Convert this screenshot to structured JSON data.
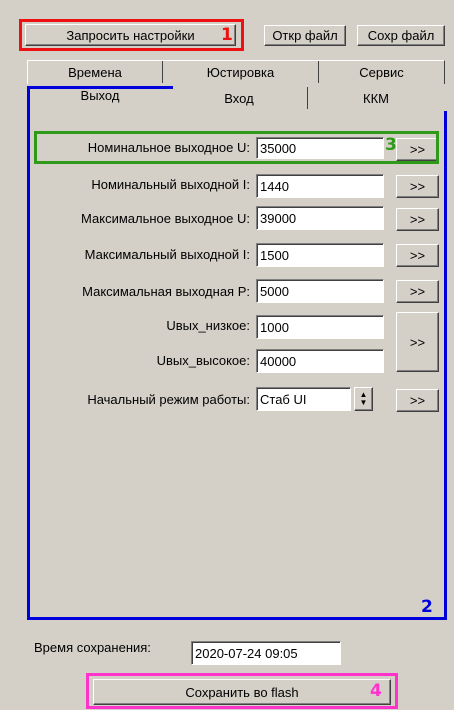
{
  "toolbar": {
    "request_settings": "Запросить настройки",
    "open_file": "Откр файл",
    "save_file": "Сохр файл"
  },
  "tabs": {
    "row1": [
      "Времена",
      "Юстировка",
      "Сервис"
    ],
    "row2": [
      "Выход",
      "Вход",
      "ККМ"
    ]
  },
  "params": [
    {
      "label": "Номинальное выходное U:",
      "value": "35000",
      "btn": ">>"
    },
    {
      "label": "Номинальный выходной I:",
      "value": "1440",
      "btn": ">>"
    },
    {
      "label": "Максимальное выходное U:",
      "value": "39000",
      "btn": ">>"
    },
    {
      "label": "Максимальный выходной I:",
      "value": "1500",
      "btn": ">>"
    },
    {
      "label": "Максимальная выходная P:",
      "value": "5000",
      "btn": ">>"
    },
    {
      "label": "Uвых_низкое:",
      "value": "1000"
    },
    {
      "label": "Uвых_высокое:",
      "value": "40000"
    }
  ],
  "range_btn": ">>",
  "mode": {
    "label": "Начальный режим работы:",
    "value": "Стаб UI",
    "btn": ">>"
  },
  "save_time": {
    "label": "Время сохранения:",
    "value": "2020-07-24 09:05"
  },
  "save_flash": "Сохранить во flash",
  "annotations": [
    "1",
    "2",
    "3",
    "4"
  ],
  "colors": {
    "red": "#ee1111",
    "blue": "#0000dd",
    "green": "#2f9a1a",
    "magenta": "#ff33cc"
  }
}
